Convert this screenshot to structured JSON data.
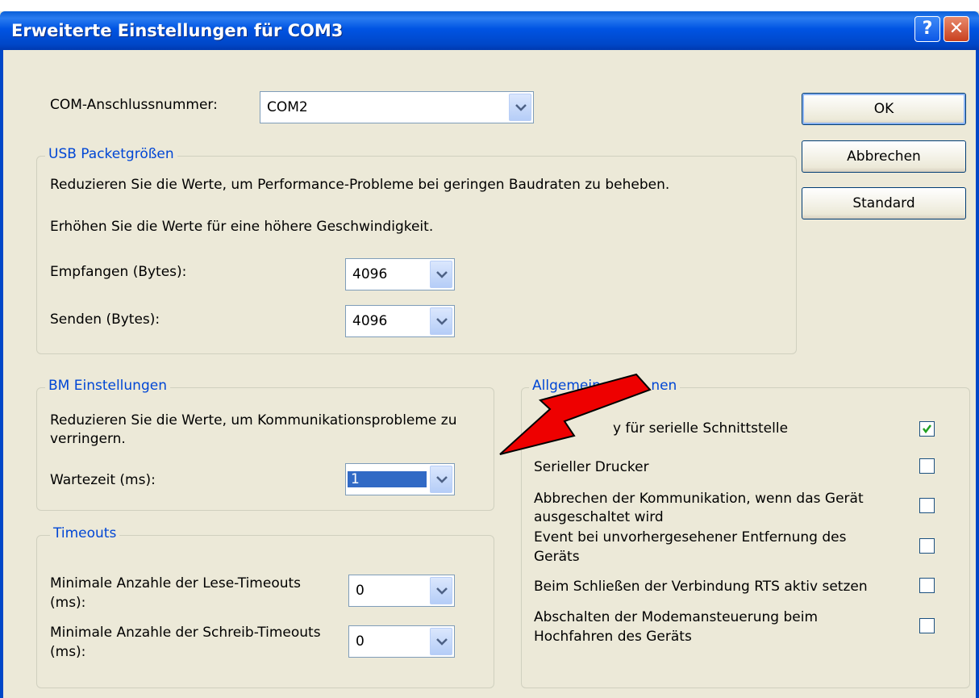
{
  "window": {
    "title": "Erweiterte Einstellungen für COM3",
    "help_icon": "?",
    "close_icon": "✕"
  },
  "com": {
    "label": "COM-Anschlussnummer:",
    "value": "COM2"
  },
  "buttons": {
    "ok": "OK",
    "cancel": "Abbrechen",
    "default": "Standard"
  },
  "usb": {
    "legend": "USB Packetgrößen",
    "text1": "Reduzieren Sie die Werte, um Performance-Probleme bei geringen Baudraten zu beheben.",
    "text2": "Erhöhen Sie die Werte für eine höhere Geschwindigkeit.",
    "receive_label": "Empfangen (Bytes):",
    "receive_value": "4096",
    "send_label": "Senden (Bytes):",
    "send_value": "4096"
  },
  "bm": {
    "legend": "BM Einstellungen",
    "text_line1": "Reduzieren Sie die Werte, um Kommunikationsprobleme zu",
    "text_line2": "verringern.",
    "wait_label": "Wartezeit (ms):",
    "wait_value": "1"
  },
  "timeouts": {
    "legend": "Timeouts",
    "read_label_1": "Minimale Anzahle der Lese-Timeouts",
    "read_label_2": "(ms):",
    "read_value": "0",
    "write_label_1": "Minimale Anzahle der Schreib-Timeouts",
    "write_label_2": "(ms):",
    "write_value": "0"
  },
  "general": {
    "legend_left": "Allgemeine",
    "legend_right": "nen",
    "options": [
      {
        "line1": "y für serielle Schnittstelle",
        "line2": "",
        "checked": true
      },
      {
        "line1": "Serieller Drucker",
        "line2": "",
        "checked": false
      },
      {
        "line1": "Abbrechen der Kommunikation, wenn das Gerät",
        "line2": "ausgeschaltet wird",
        "checked": false
      },
      {
        "line1": "Event bei unvorhergesehener Entfernung des",
        "line2": "Geräts",
        "checked": false
      },
      {
        "line1": "Beim Schließen der Verbindung RTS aktiv setzen",
        "line2": "",
        "checked": false
      },
      {
        "line1": "Abschalten der Modemansteuerung beim",
        "line2": "Hochfahren des Geräts",
        "checked": false
      }
    ]
  },
  "colors": {
    "title_bar": "#0054e3",
    "dialog_bg": "#ece9d8",
    "legend_text": "#0046d5",
    "arrow": "#ee0000"
  }
}
